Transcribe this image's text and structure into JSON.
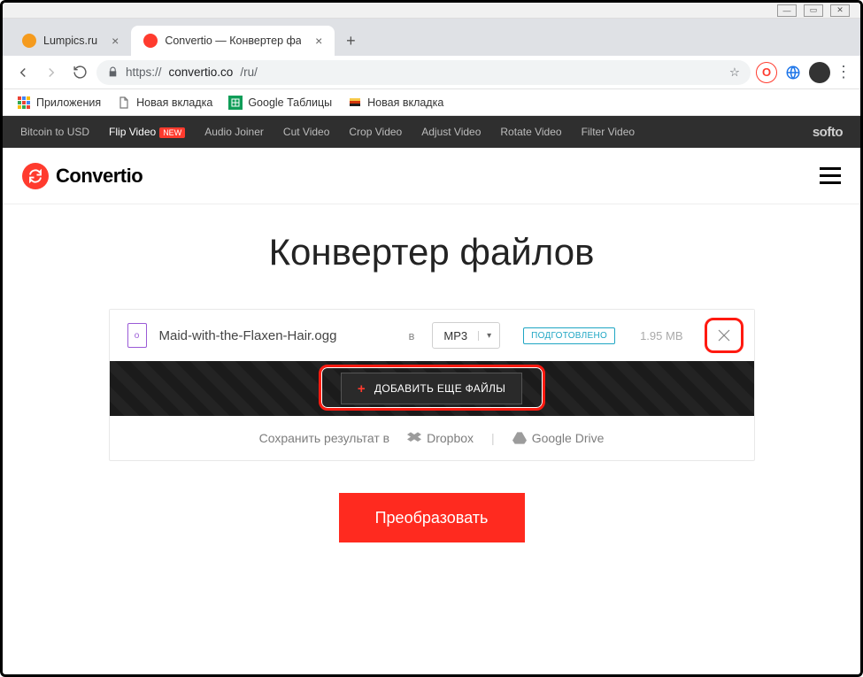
{
  "tabs": [
    {
      "title": "Lumpics.ru",
      "favicon_color": "#f59b1e"
    },
    {
      "title": "Convertio — Конвертер файлов",
      "favicon_color": "#ff3b2e"
    }
  ],
  "address": {
    "scheme": "https://",
    "host": "convertio.co",
    "path": "/ru/"
  },
  "bookmarks": [
    {
      "label": "Приложения",
      "icon": "apps"
    },
    {
      "label": "Новая вкладка",
      "icon": "page"
    },
    {
      "label": "Google Таблицы",
      "icon": "sheets"
    },
    {
      "label": "Новая вкладка",
      "icon": "flag"
    }
  ],
  "topbar": {
    "items": [
      "Bitcoin to USD",
      "Flip Video",
      "Audio Joiner",
      "Cut Video",
      "Crop Video",
      "Adjust Video",
      "Rotate Video",
      "Filter Video"
    ],
    "new_index": 1,
    "new_badge": "NEW",
    "brand": "softo"
  },
  "logo_text": "Convertio",
  "page_title": "Конвертер файлов",
  "file": {
    "name": "Maid-with-the-Flaxen-Hair.ogg",
    "to_label": "в",
    "format": "MP3",
    "status": "ПОДГОТОВЛЕНО",
    "size": "1.95 MB"
  },
  "add_more_label": "ДОБАВИТЬ ЕЩЕ ФАЙЛЫ",
  "save_to": {
    "label": "Сохранить результат в",
    "options": [
      "Dropbox",
      "Google Drive"
    ]
  },
  "cta_label": "Преобразовать"
}
